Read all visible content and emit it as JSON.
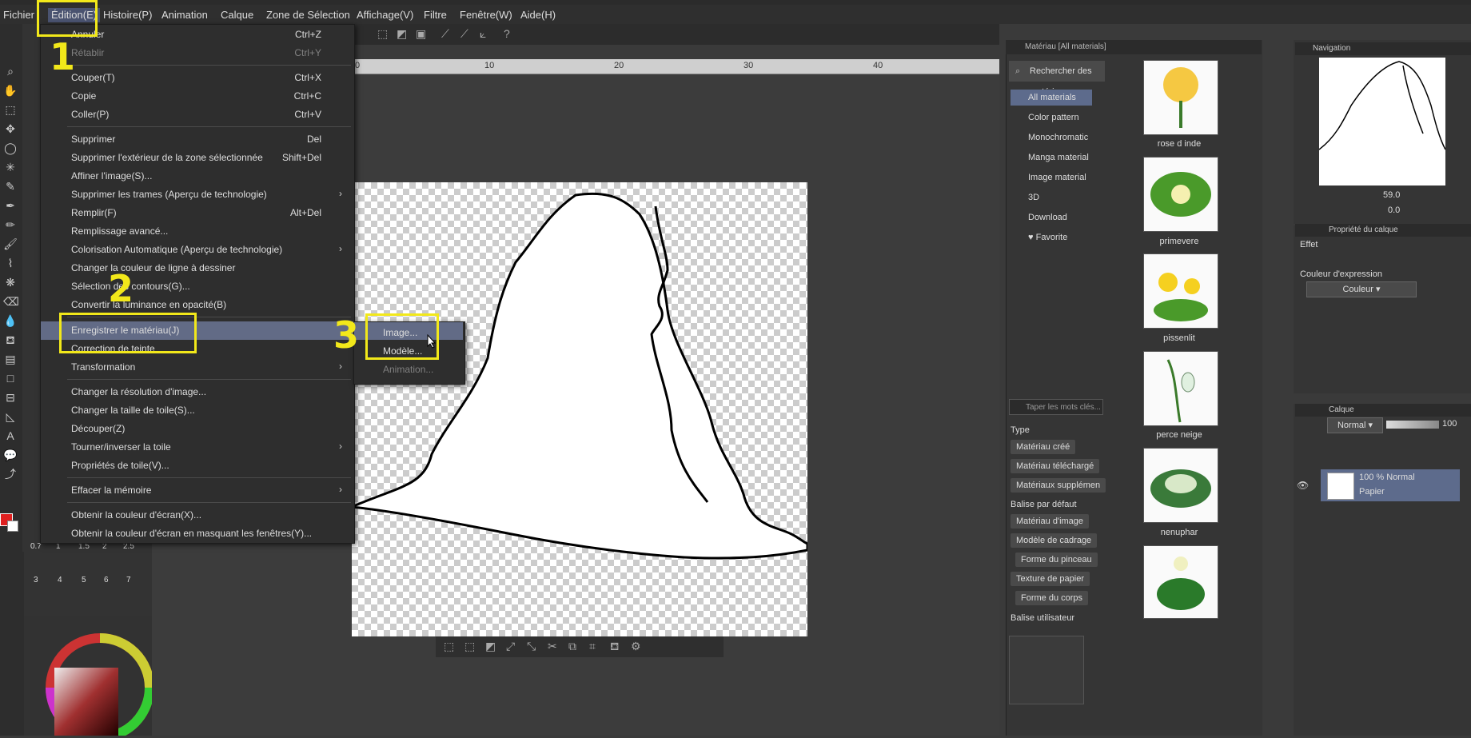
{
  "menubar": {
    "items": [
      "Fichier",
      "Édition(E)",
      "Histoire(P)",
      "Animation",
      "Calque",
      "Zone de Sélection",
      "Affichage(V)",
      "Filtre",
      "Fenêtre(W)",
      "Aide(H)"
    ]
  },
  "edit_menu": {
    "items": [
      {
        "label": "Annuler",
        "shortcut": "Ctrl+Z",
        "disabled": false
      },
      {
        "label": "Rétablir",
        "shortcut": "Ctrl+Y",
        "disabled": true
      },
      {
        "label": "Couper(T)",
        "shortcut": "Ctrl+X",
        "disabled": false
      },
      {
        "label": "Copie",
        "shortcut": "Ctrl+C",
        "disabled": false
      },
      {
        "label": "Coller(P)",
        "shortcut": "Ctrl+V",
        "disabled": false
      },
      {
        "label": "Supprimer",
        "shortcut": "Del",
        "disabled": false
      },
      {
        "label": "Supprimer l'extérieur de la zone sélectionnée",
        "shortcut": "Shift+Del",
        "disabled": false
      },
      {
        "label": "Affiner l'image(S)...",
        "shortcut": "",
        "disabled": false
      },
      {
        "label": "Supprimer les trames (Aperçu de technologie)",
        "shortcut": "",
        "disabled": false
      },
      {
        "label": "Remplir(F)",
        "shortcut": "Alt+Del",
        "disabled": false
      },
      {
        "label": "Remplissage avancé...",
        "shortcut": "",
        "disabled": false
      },
      {
        "label": "Colorisation Automatique (Aperçu de technologie)",
        "shortcut": "",
        "disabled": false
      },
      {
        "label": "Changer la couleur de ligne à dessiner",
        "shortcut": "",
        "disabled": false
      },
      {
        "label": "Sélection des contours(G)...",
        "shortcut": "",
        "disabled": false
      },
      {
        "label": "Convertir la luminance en opacité(B)",
        "shortcut": "",
        "disabled": false
      },
      {
        "label": "Enregistrer le matériau(J)",
        "shortcut": "",
        "disabled": false
      },
      {
        "label": "Correction de teinte",
        "shortcut": "",
        "disabled": false
      },
      {
        "label": "Transformation",
        "shortcut": "",
        "disabled": false
      },
      {
        "label": "Changer la résolution d'image...",
        "shortcut": "",
        "disabled": false
      },
      {
        "label": "Changer la taille de toile(S)...",
        "shortcut": "",
        "disabled": false
      },
      {
        "label": "Découper(Z)",
        "shortcut": "",
        "disabled": false
      },
      {
        "label": "Tourner/inverser la toile",
        "shortcut": "",
        "disabled": false
      },
      {
        "label": "Propriétés de toile(V)...",
        "shortcut": "",
        "disabled": false
      },
      {
        "label": "Effacer la mémoire",
        "shortcut": "",
        "disabled": false
      },
      {
        "label": "Obtenir la couleur d'écran(X)...",
        "shortcut": "",
        "disabled": false
      },
      {
        "label": "Obtenir la couleur d'écran en masquant les fenêtres(Y)...",
        "shortcut": "",
        "disabled": false
      }
    ]
  },
  "submenu": {
    "items": [
      {
        "label": "Image...",
        "disabled": false
      },
      {
        "label": "Modèle...",
        "disabled": false
      },
      {
        "label": "Animation...",
        "disabled": true
      }
    ]
  },
  "annotations": [
    "1",
    "2",
    "3"
  ],
  "ruler": {
    "ticks": [
      "0",
      "10",
      "20",
      "30",
      "40"
    ]
  },
  "material_panel": {
    "title": "Matériau [All materials]",
    "search_button": "Rechercher des matériau",
    "tree": [
      "All materials",
      "Color pattern",
      "Monochromatic",
      "Manga material",
      "Image material",
      "3D",
      "Download",
      "Favorite"
    ],
    "items": [
      "rose d inde",
      "primevere",
      "pissenlit",
      "perce neige",
      "nenuphar"
    ],
    "keyword_placeholder": "Taper les mots clés...",
    "type_heading": "Type",
    "type_tags": [
      "Matériau créé",
      "Matériau téléchargé",
      "Matériaux supplémen"
    ],
    "default_tag_heading": "Balise par défaut",
    "default_tags": [
      "Matériau d'image",
      "Modèle de cadrage",
      "Forme du pinceau",
      "Texture de papier",
      "Forme du corps"
    ],
    "user_tag_heading": "Balise utilisateur"
  },
  "navigation": {
    "title": "Navigation",
    "zoom": "59.0",
    "angle": "0.0"
  },
  "layer_property": {
    "title": "Propriété du calque",
    "effect_label": "Effet",
    "expression_label": "Couleur d'expression",
    "expression_value": "Couleur"
  },
  "layer_panel": {
    "title": "Calque",
    "blend_mode": "Normal",
    "opacity": "100",
    "layer_info": "100 % Normal",
    "layer_name": "Papier"
  },
  "brush_sizes": [
    "0.7",
    "1",
    "1.5",
    "2",
    "2.5",
    "3",
    "4",
    "5",
    "6",
    "7"
  ],
  "colors": {
    "accent_highlight": "#626b86",
    "annotation": "#f2e81a",
    "main_color": "#e02020"
  }
}
